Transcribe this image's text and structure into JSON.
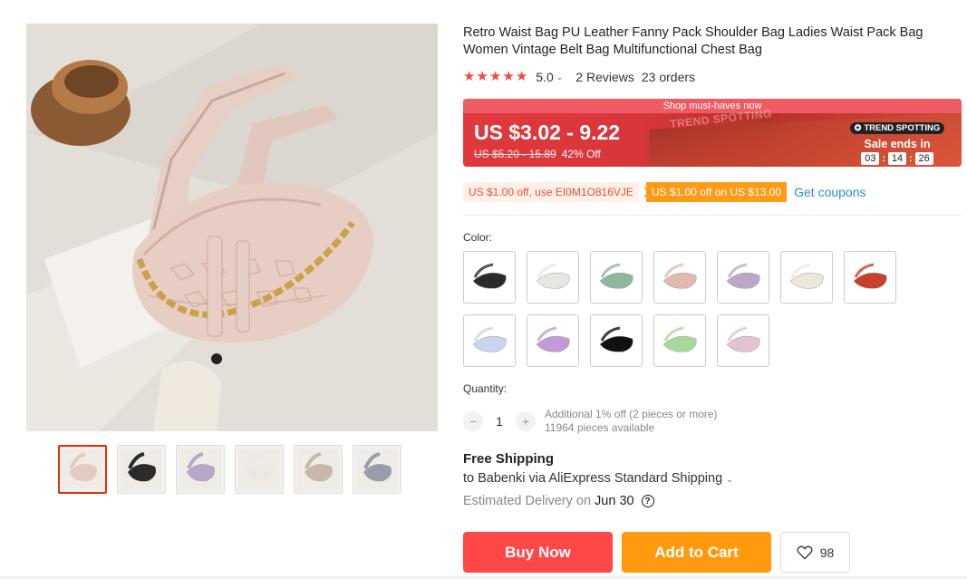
{
  "product": {
    "title": "Retro Waist Bag PU Leather Fanny Pack Shoulder Bag Ladies Waist Pack Bag Women Vintage Belt Bag Multifunctional Chest Bag",
    "rating": "5.0",
    "reviews": "2 Reviews",
    "orders": "23 orders"
  },
  "gallery": {
    "main_image_icon": "pink-croc-waist-bag-photo",
    "thumbnails": [
      {
        "name": "thumb-pink-bag",
        "color": "#e6c9c0",
        "active": true
      },
      {
        "name": "thumb-black-bag",
        "color": "#2b2b2b",
        "active": false
      },
      {
        "name": "thumb-purple-bag",
        "color": "#b7a7c9",
        "active": false
      },
      {
        "name": "thumb-white-bag",
        "color": "#ece8e2",
        "active": false
      },
      {
        "name": "thumb-color-chart",
        "color": "#c8b8a8",
        "active": false
      },
      {
        "name": "thumb-grey-bag",
        "color": "#9a9cab",
        "active": false
      }
    ]
  },
  "price": {
    "promo_strip": "Shop must-haves now",
    "current": "US $3.02 - 9.22",
    "original": "US $5.20 - 15.89",
    "discount": "42% Off",
    "trend_badge": "TREND SPOTTING",
    "watermark": "TREND SPOTTING",
    "sale_ends": "Sale ends in",
    "countdown": [
      "03",
      "14",
      "26"
    ]
  },
  "coupons": {
    "code_coupon": "US $1.00 off, use EI0M1O816VJE",
    "store_coupon": "US $1.00 off on US $13.00",
    "get_link": "Get coupons"
  },
  "color": {
    "label": "Color:",
    "swatches": [
      {
        "name": "swatch-black",
        "color": "#2a2a2a"
      },
      {
        "name": "swatch-white",
        "color": "#e8e6e2"
      },
      {
        "name": "swatch-green",
        "color": "#8fb7a0"
      },
      {
        "name": "swatch-pink",
        "color": "#e2b9b0"
      },
      {
        "name": "swatch-purple",
        "color": "#bda7c6"
      },
      {
        "name": "swatch-cream",
        "color": "#efe6da"
      },
      {
        "name": "swatch-red",
        "color": "#c8402e"
      },
      {
        "name": "swatch-lavender-holo",
        "color": "#c9d4f0"
      },
      {
        "name": "swatch-purple-holo",
        "color": "#c29ad8"
      },
      {
        "name": "swatch-black-nylon",
        "color": "#111111"
      },
      {
        "name": "swatch-green-holo",
        "color": "#a9d99a"
      },
      {
        "name": "swatch-pink-holo",
        "color": "#e3c3d3"
      }
    ]
  },
  "quantity": {
    "label": "Quantity:",
    "minus": "−",
    "plus": "+",
    "value": "1",
    "note1": "Additional 1% off (2 pieces or more)",
    "note2": "11964 pieces available"
  },
  "shipping": {
    "title": "Free Shipping",
    "line": "to Babenki via AliExpress Standard Shipping",
    "est_label": "Estimated Delivery on",
    "est_date": "Jun 30"
  },
  "actions": {
    "buy_now": "Buy Now",
    "add_to_cart": "Add to Cart",
    "wishlist_count": "98"
  },
  "colors": {
    "accent_red": "#ff4747",
    "accent_orange": "#ff9a0e",
    "star": "#f04a3c",
    "link": "#2e8bd6"
  }
}
